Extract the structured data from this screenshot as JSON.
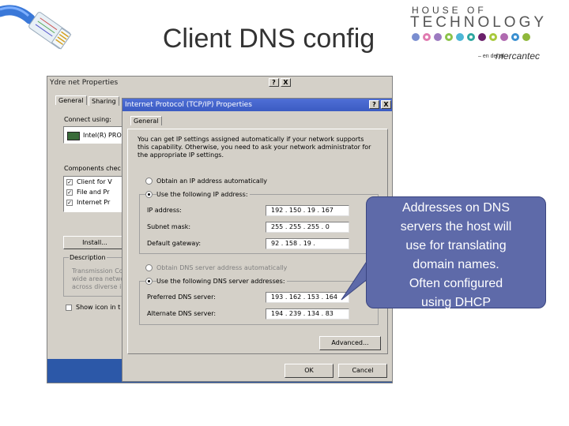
{
  "slide": {
    "title": "Client DNS config"
  },
  "logo": {
    "line1": "HOUSE OF",
    "line2": "TECHNOLOGY",
    "by": "– en del af",
    "brand": "mercantec",
    "dot_colors": [
      "#7a8ed0",
      "#e07bb0",
      "#9c7ac0",
      "#8bc34a",
      "#4db6d6",
      "#2ea7a0",
      "#6a1f6a",
      "#a8c93c",
      "#b06ab0",
      "#3a8fd0",
      "#8fb83a"
    ]
  },
  "back_dialog": {
    "title": "Ydre net Properties",
    "help_btn": "?",
    "close_btn": "X",
    "tabs": [
      "General",
      "Sharing"
    ],
    "connect_using_label": "Connect using:",
    "adapter": "Intel(R) PRO",
    "components_label": "Components chec",
    "components": [
      "Client for V",
      "File and Pr",
      "Internet Pr"
    ],
    "install_btn": "Install...",
    "description_label": "Description",
    "description_text": [
      "Transmission Co",
      "wide area netwo",
      "across diverse i"
    ],
    "show_icon_label": "Show icon in t"
  },
  "front_dialog": {
    "title": "Internet Protocol (TCP/IP) Properties",
    "help_btn": "?",
    "close_btn": "X",
    "tab": "General",
    "intro": [
      "You can get IP settings assigned automatically if your network supports",
      "this capability. Otherwise, you need to ask your network administrator for",
      "the appropriate IP settings."
    ],
    "ip_auto": "Obtain an IP address automatically",
    "ip_manual": "Use the following IP address:",
    "ip_label": "IP address:",
    "ip_value": "192 . 150 . 19 . 167",
    "mask_label": "Subnet mask:",
    "mask_value": "255 . 255 . 255 . 0",
    "gateway_label": "Default gateway:",
    "gateway_value": "92 . 158 . 19 .",
    "dns_auto": "Obtain DNS server address automatically",
    "dns_manual": "Use the following DNS server addresses:",
    "pref_dns_label": "Preferred DNS server:",
    "pref_dns_value": "193 . 162 . 153 . 164",
    "alt_dns_label": "Alternate DNS server:",
    "alt_dns_value": "194 . 239 . 134 . 83",
    "advanced_btn": "Advanced...",
    "ok_btn": "OK",
    "cancel_btn": "Cancel"
  },
  "callout": {
    "lines": [
      "Addresses on DNS",
      "servers the host will",
      "use for translating",
      "domain names.",
      "Often configured",
      "using DHCP"
    ]
  }
}
